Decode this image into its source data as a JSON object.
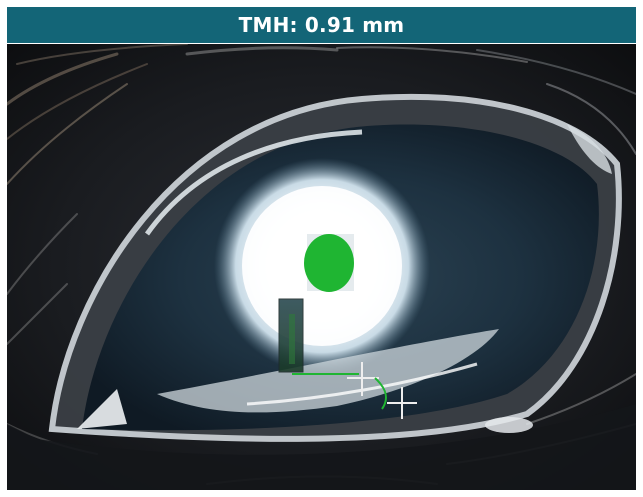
{
  "header": {
    "title": "TMH: 0.91 mm"
  },
  "image": {
    "subject": "canine-eye-photograph"
  },
  "overlay": {
    "tear_meniscus_marker": "crosshair",
    "reflection_marker": "green-dot",
    "measurement_box": "vertical-strip"
  },
  "colors": {
    "header_bg": "#136577",
    "header_text": "#ffffff",
    "green_marker": "#1fb532",
    "crosshair": "#eeeeee"
  }
}
